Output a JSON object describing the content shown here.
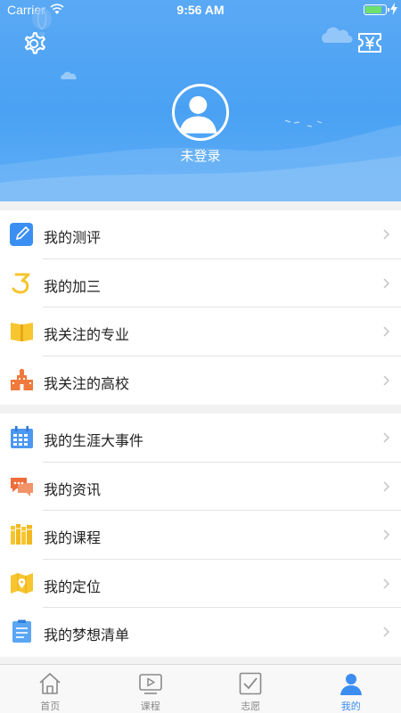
{
  "status_bar": {
    "carrier": "Carrier",
    "time": "9:56 AM"
  },
  "profile": {
    "login_status": "未登录"
  },
  "menu_group_1": [
    {
      "label": "我的测评",
      "icon": "edit-note-icon"
    },
    {
      "label": "我的加三",
      "icon": "number-three-icon"
    },
    {
      "label": "我关注的专业",
      "icon": "open-book-icon"
    },
    {
      "label": "我关注的高校",
      "icon": "school-building-icon"
    }
  ],
  "menu_group_2": [
    {
      "label": "我的生涯大事件",
      "icon": "calendar-icon"
    },
    {
      "label": "我的资讯",
      "icon": "chat-bubble-icon"
    },
    {
      "label": "我的课程",
      "icon": "books-icon"
    },
    {
      "label": "我的定位",
      "icon": "map-pin-icon"
    },
    {
      "label": "我的梦想清单",
      "icon": "checklist-icon"
    }
  ],
  "tabs": [
    {
      "label": "首页",
      "icon": "home-icon",
      "active": false
    },
    {
      "label": "课程",
      "icon": "video-play-icon",
      "active": false
    },
    {
      "label": "志愿",
      "icon": "checkbox-icon",
      "active": false
    },
    {
      "label": "我的",
      "icon": "user-icon",
      "active": true
    }
  ],
  "colors": {
    "header_blue": "#4aa1f3",
    "tab_active": "#3b8df0",
    "tab_inactive": "#888888"
  },
  "header_icons": {
    "settings": "gear-icon",
    "wallet": "ticket-yen-icon"
  }
}
